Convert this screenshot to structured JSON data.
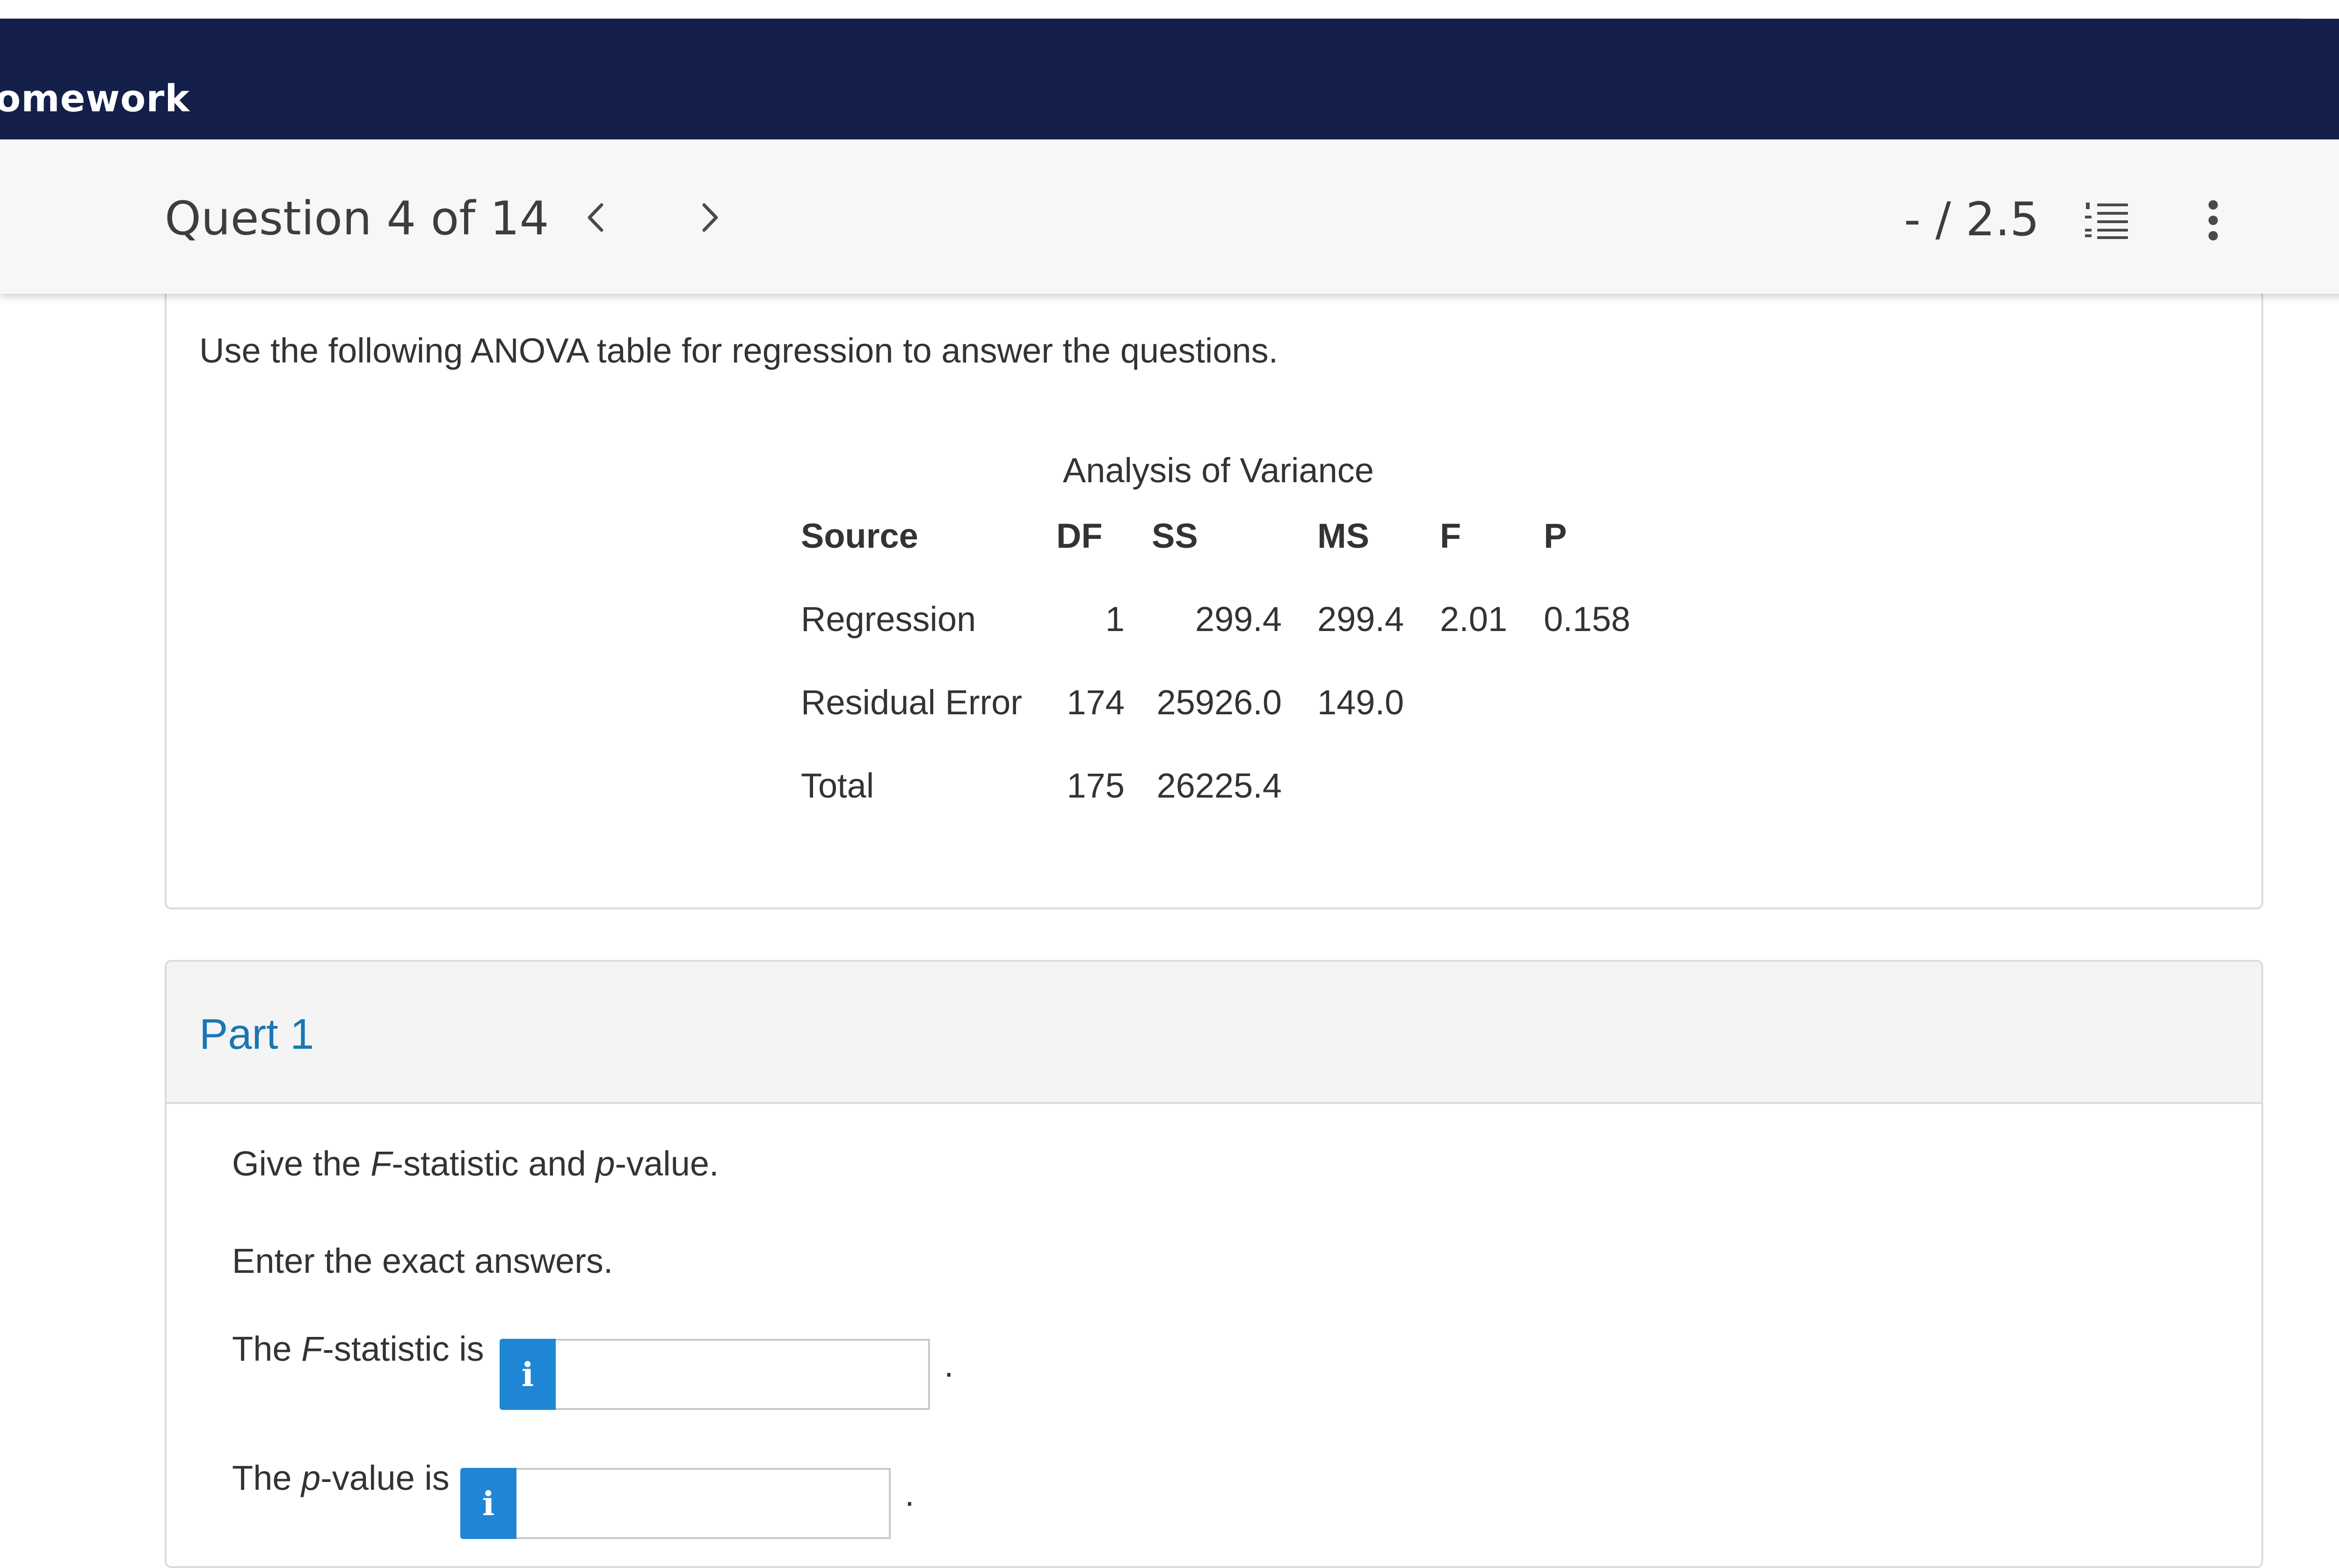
{
  "app": {
    "title": "omework"
  },
  "header": {
    "question_label": "Question 4 of 14",
    "score": "- / 2.5",
    "icons": {
      "prev": "chevron-left-icon",
      "next": "chevron-right-icon",
      "list": "numbered-list-icon",
      "more": "more-vertical-icon"
    }
  },
  "question": {
    "intro": "Use the following ANOVA table for regression to answer the questions.",
    "anova": {
      "title": "Analysis of Variance",
      "headers": [
        "Source",
        "DF",
        "SS",
        "MS",
        "F",
        "P"
      ],
      "rows": [
        {
          "source": "Regression",
          "df": "1",
          "ss": "299.4",
          "ms": "299.4",
          "f": "2.01",
          "p": "0.158"
        },
        {
          "source": "Residual Error",
          "df": "174",
          "ss": "25926.0",
          "ms": "149.0",
          "f": "",
          "p": ""
        },
        {
          "source": "Total",
          "df": "175",
          "ss": "26225.4",
          "ms": "",
          "f": "",
          "p": ""
        }
      ]
    }
  },
  "part1": {
    "title": "Part 1",
    "prompt": {
      "pre": "Give the ",
      "f": "F",
      "mid": "-statistic and ",
      "p": "p",
      "post": "-value."
    },
    "instruction": "Enter the exact answers.",
    "f_field": {
      "pre": "The ",
      "var": "F",
      "post": "-statistic is",
      "info_label": "i",
      "value": "",
      "period": "."
    },
    "p_field": {
      "pre": "The ",
      "var": "p",
      "post": "-value is",
      "info_label": "i",
      "value": "",
      "period": "."
    }
  }
}
